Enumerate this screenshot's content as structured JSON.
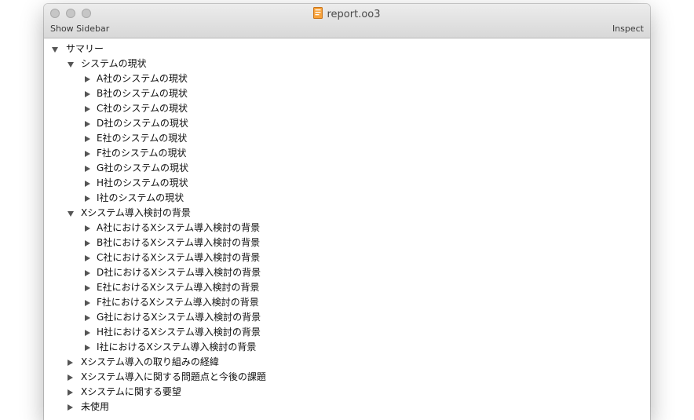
{
  "window": {
    "title": "report.oo3",
    "show_sidebar_label": "Show Sidebar",
    "inspect_label": "Inspect"
  },
  "outline": {
    "root_label": "サマリー",
    "section1": {
      "label": "システムの現状",
      "items": [
        "A社のシステムの現状",
        "B社のシステムの現状",
        "C社のシステムの現状",
        "D社のシステムの現状",
        "E社のシステムの現状",
        "F社のシステムの現状",
        "G社のシステムの現状",
        "H社のシステムの現状",
        "I社のシステムの現状"
      ]
    },
    "section2": {
      "label": "Xシステム導入検討の背景",
      "items": [
        "A社におけるXシステム導入検討の背景",
        "B社におけるXシステム導入検討の背景",
        "C社におけるXシステム導入検討の背景",
        "D社におけるXシステム導入検討の背景",
        "E社におけるXシステム導入検討の背景",
        "F社におけるXシステム導入検討の背景",
        "G社におけるXシステム導入検討の背景",
        "H社におけるXシステム導入検討の背景",
        "I社におけるXシステム導入検討の背景"
      ]
    },
    "collapsed_sections": [
      "Xシステム導入の取り組みの経緯",
      "Xシステム導入に関する問題点と今後の課題",
      "Xシステムに関する要望",
      "未使用"
    ]
  }
}
